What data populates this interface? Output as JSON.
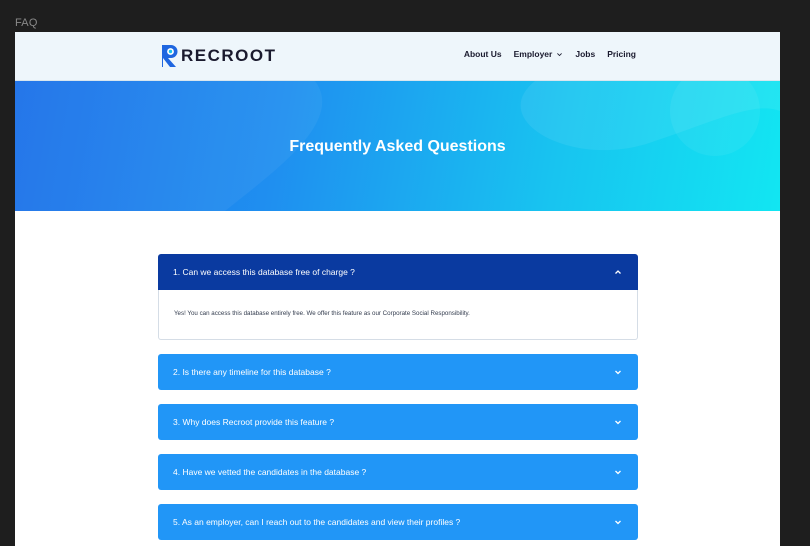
{
  "frame": {
    "label": "FAQ"
  },
  "nav": {
    "brand": "RECROOT",
    "links": [
      {
        "label": "About Us"
      },
      {
        "label": "Employer"
      },
      {
        "label": "Jobs"
      },
      {
        "label": "Pricing"
      }
    ]
  },
  "hero": {
    "title": "Frequently Asked Questions"
  },
  "faq": {
    "items": [
      {
        "question": "1. Can we access this database free of charge ?",
        "answer": "Yes! You can access this database entirely free. We offer this feature as our Corporate Social Responsibility.",
        "expanded": true
      },
      {
        "question": "2. Is there any timeline for this database ?",
        "expanded": false
      },
      {
        "question": "3. Why does Recroot provide this feature ?",
        "expanded": false
      },
      {
        "question": "4. Have we vetted the candidates in the database ?",
        "expanded": false
      },
      {
        "question": "5. As an employer, can I reach out to the candidates and view their profiles ?",
        "expanded": false
      }
    ]
  },
  "colors": {
    "accent": "#2196f7",
    "accent_active": "#0a3aa0",
    "brand_dark": "#1a1a2e"
  },
  "icons": [
    "recroot-logo-icon",
    "chevron-down-icon",
    "chevron-up-icon"
  ]
}
